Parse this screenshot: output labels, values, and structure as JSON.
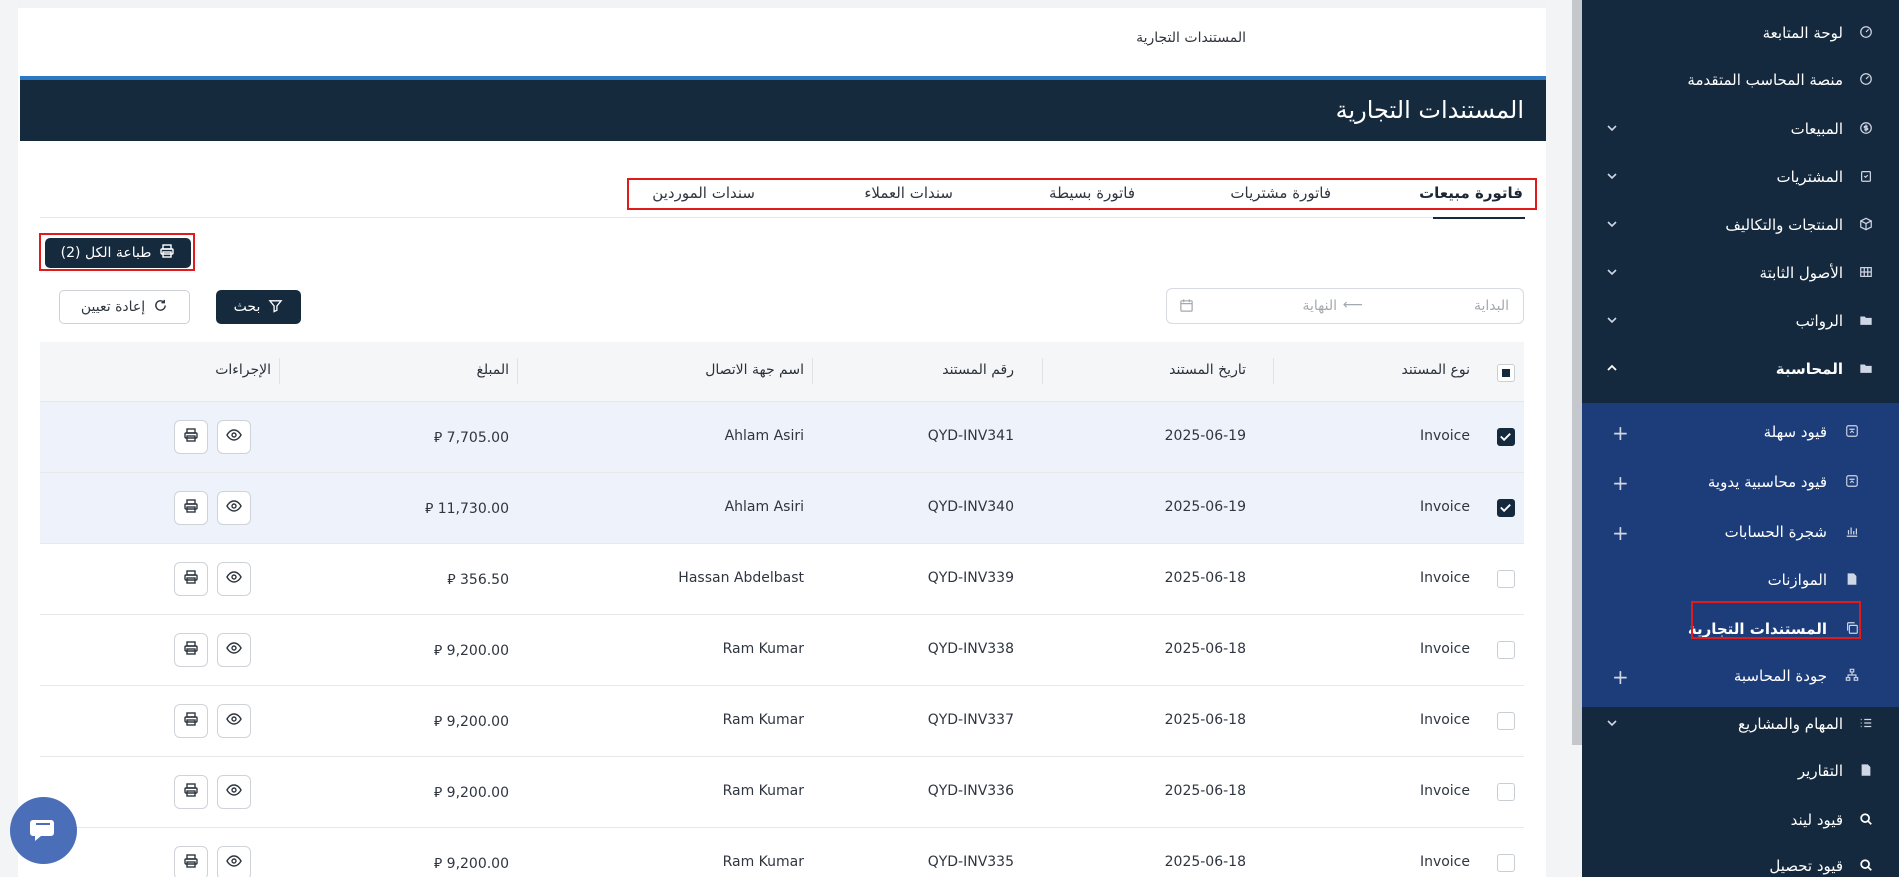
{
  "breadcrumb": "المستندات التجارية",
  "page_title": "المستندات التجارية",
  "tabs": [
    {
      "label": "فاتورة مبيعات",
      "active": true
    },
    {
      "label": "فاتورة مشتريات"
    },
    {
      "label": "فاتورة بسيطة"
    },
    {
      "label": "سندات العملاء"
    },
    {
      "label": "سندات الموردين"
    }
  ],
  "toolbar": {
    "print_all_label": "طباعة الكل (2)",
    "search_label": "بحث",
    "reset_label": "إعادة تعيين"
  },
  "date_range": {
    "start_placeholder": "البداية",
    "end_placeholder": "النهاية"
  },
  "table": {
    "columns": [
      "نوع المستند",
      "تاريخ المستند",
      "رقم المستند",
      "اسم جهة الاتصال",
      "المبلغ",
      "الإجراءات"
    ],
    "currency_symbol": "⃁",
    "rows": [
      {
        "type": "Invoice",
        "date": "2025-06-19",
        "number": "QYD-INV341",
        "contact": "Ahlam Asiri",
        "amount": "7,705.00",
        "selected": true
      },
      {
        "type": "Invoice",
        "date": "2025-06-19",
        "number": "QYD-INV340",
        "contact": "Ahlam Asiri",
        "amount": "11,730.00",
        "selected": true
      },
      {
        "type": "Invoice",
        "date": "2025-06-18",
        "number": "QYD-INV339",
        "contact": "Hassan Abdelbast",
        "amount": "356.50",
        "selected": false
      },
      {
        "type": "Invoice",
        "date": "2025-06-18",
        "number": "QYD-INV338",
        "contact": "Ram Kumar",
        "amount": "9,200.00",
        "selected": false
      },
      {
        "type": "Invoice",
        "date": "2025-06-18",
        "number": "QYD-INV337",
        "contact": "Ram Kumar",
        "amount": "9,200.00",
        "selected": false
      },
      {
        "type": "Invoice",
        "date": "2025-06-18",
        "number": "QYD-INV336",
        "contact": "Ram Kumar",
        "amount": "9,200.00",
        "selected": false
      },
      {
        "type": "Invoice",
        "date": "2025-06-18",
        "number": "QYD-INV335",
        "contact": "Ram Kumar",
        "amount": "9,200.00",
        "selected": false
      }
    ]
  },
  "sidebar": {
    "items": [
      {
        "label": "لوحة المتابعة",
        "icon": "gauge-icon"
      },
      {
        "label": "منصة المحاسب المتقدمة",
        "icon": "gauge-icon"
      },
      {
        "label": "المبيعات",
        "icon": "dollar-icon",
        "chevron": "down"
      },
      {
        "label": "المشتريات",
        "icon": "clipboard-icon",
        "chevron": "down"
      },
      {
        "label": "المنتجات والتكاليف",
        "icon": "box-icon",
        "chevron": "down"
      },
      {
        "label": "الأصول الثابتة",
        "icon": "grid-icon",
        "chevron": "down"
      },
      {
        "label": "الرواتب",
        "icon": "folder-icon",
        "chevron": "down"
      },
      {
        "label": "المحاسبة",
        "icon": "folder-icon",
        "chevron": "up"
      }
    ],
    "sub_items": [
      {
        "label": "قيود سهلة",
        "icon": "scale-icon",
        "plus": true
      },
      {
        "label": "قيود محاسبية يدوية",
        "icon": "scale-icon",
        "plus": true
      },
      {
        "label": "شجرة الحسابات",
        "icon": "chart-icon",
        "plus": true
      },
      {
        "label": "الموازنات",
        "icon": "document-icon",
        "plus": false
      },
      {
        "label": "المستندات التجارية",
        "icon": "copy-icon",
        "plus": false,
        "active": true
      },
      {
        "label": "جودة المحاسبة",
        "icon": "sitemap-icon",
        "plus": true
      }
    ],
    "bottom_items": [
      {
        "label": "المهام والمشاريع",
        "icon": "list-icon",
        "chevron": "down"
      },
      {
        "label": "التقارير",
        "icon": "document-icon"
      },
      {
        "label": "قيود ليند",
        "icon": "search-icon"
      },
      {
        "label": "قيود تحصيل",
        "icon": "search-icon"
      }
    ]
  },
  "colors": {
    "primary": "#162a3e",
    "accent": "#2b78c5",
    "submenu": "#1d3d7a",
    "highlight": "#e01b1b"
  }
}
